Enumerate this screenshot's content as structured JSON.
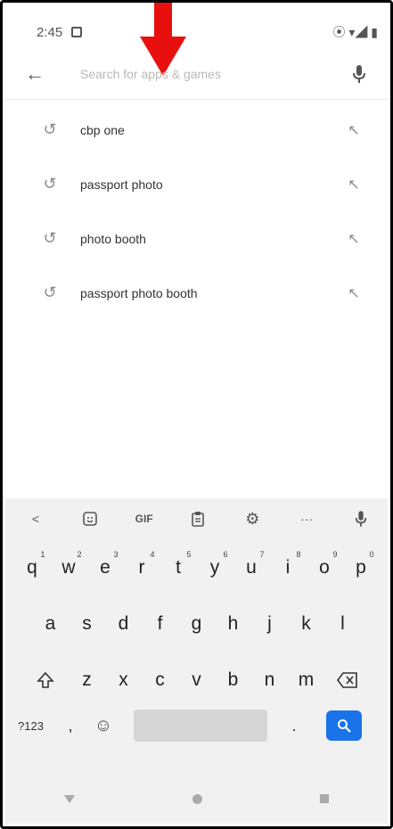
{
  "status_bar": {
    "time": "2:45",
    "icons_right": "⦿ ▾◢ ▮"
  },
  "search": {
    "placeholder": "Search for apps & games"
  },
  "suggestions": [
    {
      "label": "cbp one"
    },
    {
      "label": "passport photo"
    },
    {
      "label": "photo booth"
    },
    {
      "label": "passport photo booth"
    }
  ],
  "keyboard": {
    "toolbar": {
      "back": "<",
      "gif": "GIF",
      "more": "···"
    },
    "row1": [
      {
        "key": "q",
        "hint": "1"
      },
      {
        "key": "w",
        "hint": "2"
      },
      {
        "key": "e",
        "hint": "3"
      },
      {
        "key": "r",
        "hint": "4"
      },
      {
        "key": "t",
        "hint": "5"
      },
      {
        "key": "y",
        "hint": "6"
      },
      {
        "key": "u",
        "hint": "7"
      },
      {
        "key": "i",
        "hint": "8"
      },
      {
        "key": "o",
        "hint": "9"
      },
      {
        "key": "p",
        "hint": "0"
      }
    ],
    "row2": [
      "a",
      "s",
      "d",
      "f",
      "g",
      "h",
      "j",
      "k",
      "l"
    ],
    "row3": [
      "z",
      "x",
      "c",
      "v",
      "b",
      "n",
      "m"
    ],
    "row4": {
      "symbols": "?123",
      "comma": ",",
      "period": "."
    }
  }
}
